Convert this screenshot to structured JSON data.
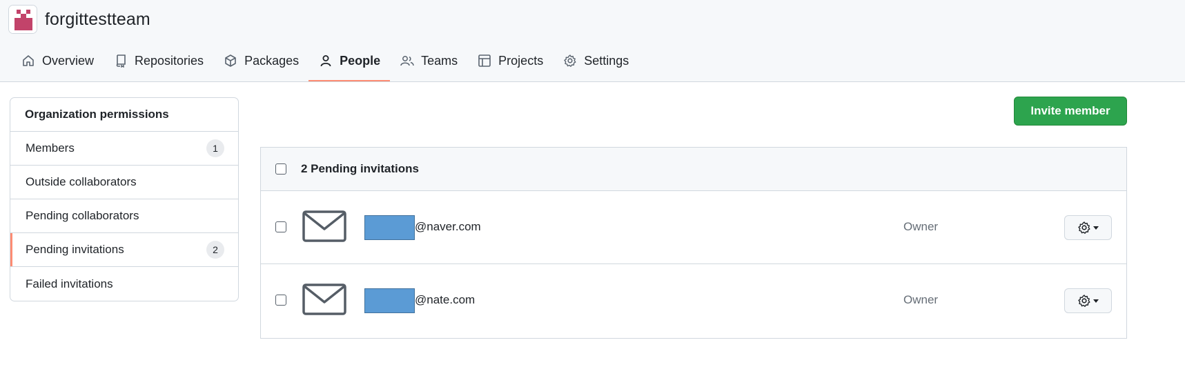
{
  "org": {
    "name": "forgittestteam",
    "avatar_color": "#c2436a"
  },
  "nav": {
    "tabs": [
      {
        "label": "Overview",
        "icon": "home-icon"
      },
      {
        "label": "Repositories",
        "icon": "repo-icon"
      },
      {
        "label": "Packages",
        "icon": "package-icon"
      },
      {
        "label": "People",
        "icon": "person-icon",
        "active": true
      },
      {
        "label": "Teams",
        "icon": "people-icon"
      },
      {
        "label": "Projects",
        "icon": "table-icon"
      },
      {
        "label": "Settings",
        "icon": "gear-icon"
      }
    ]
  },
  "sidebar": {
    "heading": "Organization permissions",
    "items": [
      {
        "label": "Members",
        "count": "1"
      },
      {
        "label": "Outside collaborators"
      },
      {
        "label": "Pending collaborators"
      },
      {
        "label": "Pending invitations",
        "count": "2",
        "selected": true
      },
      {
        "label": "Failed invitations"
      }
    ]
  },
  "actions": {
    "invite_label": "Invite member"
  },
  "invitations": {
    "title": "2 Pending invitations",
    "rows": [
      {
        "email": "@naver.com",
        "role": "Owner"
      },
      {
        "email": "@nate.com",
        "role": "Owner"
      }
    ]
  },
  "colors": {
    "accent_underline": "#fd8c73",
    "primary_button": "#2da44e",
    "redaction": "#5b9bd5"
  }
}
